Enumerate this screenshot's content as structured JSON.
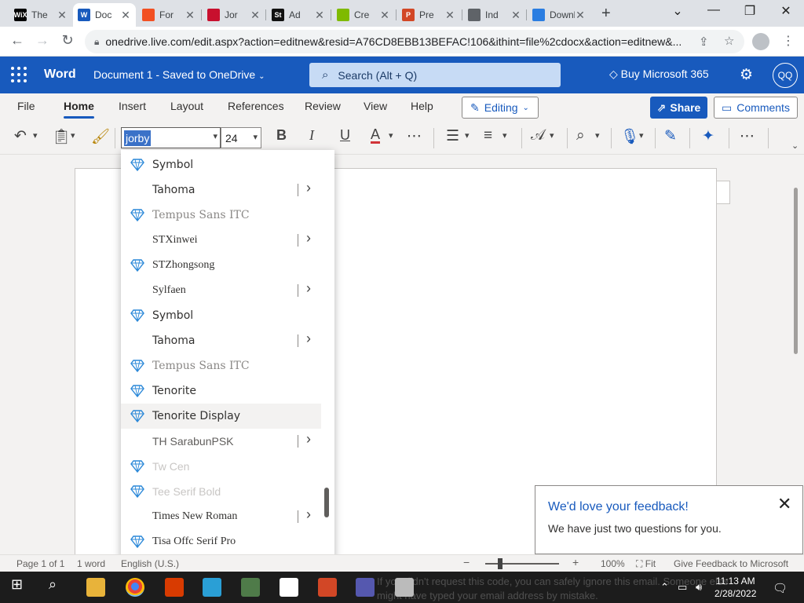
{
  "browser": {
    "tabs": [
      {
        "title": "The",
        "favicon": "wix-icon",
        "fav_text": "WiX",
        "fav_color": "#000000"
      },
      {
        "title": "Doc",
        "favicon": "word-icon",
        "fav_text": "W",
        "fav_color": "#185abd",
        "active": true
      },
      {
        "title": "For",
        "favicon": "microsoft-icon",
        "fav_text": "",
        "fav_color": "#f25022"
      },
      {
        "title": "Jor",
        "favicon": "bookmark-red-icon",
        "fav_text": "",
        "fav_color": "#c8102e"
      },
      {
        "title": "Ad",
        "favicon": "st-icon",
        "fav_text": "St",
        "fav_color": "#111111"
      },
      {
        "title": "Cre",
        "favicon": "microsoft-icon",
        "fav_text": "",
        "fav_color": "#7fba00"
      },
      {
        "title": "Pre",
        "favicon": "powerpoint-icon",
        "fav_text": "P",
        "fav_color": "#d24726"
      },
      {
        "title": "Ind",
        "favicon": "globe-icon",
        "fav_text": "",
        "fav_color": "#5f6368"
      },
      {
        "title": "Downlo",
        "favicon": "download-swirl-icon",
        "fav_text": "",
        "fav_color": "#2a7de1"
      }
    ],
    "url": "onedrive.live.com/edit.aspx?action=editnew&resid=A76CD8EBB13BEFAC!106&ithint=file%2cdocx&action=editnew&..."
  },
  "word": {
    "app_name": "Word",
    "doc_title": "Document 1  -  Saved to OneDrive",
    "search_placeholder": "Search (Alt + Q)",
    "buy_label": "Buy Microsoft 365",
    "avatar_initials": "QQ",
    "ribbon_tabs": [
      "File",
      "Home",
      "Insert",
      "Layout",
      "References",
      "Review",
      "View",
      "Help"
    ],
    "active_tab": "Home",
    "editing_label": "Editing",
    "share_label": "Share",
    "comments_label": "Comments",
    "font_name_value": "jorby",
    "font_size_value": "24"
  },
  "font_dropdown": {
    "items": [
      {
        "name": "Symbol",
        "premium": true,
        "submenu": false,
        "font": "DejaVu Sans",
        "color": "#323130"
      },
      {
        "name": "Tahoma",
        "premium": false,
        "submenu": true,
        "font": "DejaVu Sans",
        "color": "#323130"
      },
      {
        "name": "Tempus Sans ITC",
        "premium": true,
        "submenu": false,
        "font": "DejaVu Serif",
        "color": "#8a8886"
      },
      {
        "name": "STXinwei",
        "premium": false,
        "submenu": true,
        "font": "Liberation Serif",
        "color": "#323130"
      },
      {
        "name": "STZhongsong",
        "premium": true,
        "submenu": false,
        "font": "Liberation Serif",
        "color": "#323130"
      },
      {
        "name": "Sylfaen",
        "premium": false,
        "submenu": true,
        "font": "Liberation Serif",
        "color": "#323130"
      },
      {
        "name": "Symbol",
        "premium": true,
        "submenu": false,
        "font": "DejaVu Sans",
        "color": "#323130"
      },
      {
        "name": "Tahoma",
        "premium": false,
        "submenu": true,
        "font": "DejaVu Sans",
        "color": "#323130"
      },
      {
        "name": "Tempus Sans ITC",
        "premium": true,
        "submenu": false,
        "font": "DejaVu Serif",
        "color": "#8a8886"
      },
      {
        "name": "Tenorite",
        "premium": true,
        "submenu": false,
        "font": "DejaVu Sans",
        "color": "#323130"
      },
      {
        "name": "Tenorite Display",
        "premium": true,
        "submenu": false,
        "font": "DejaVu Sans",
        "color": "#323130",
        "hover": true
      },
      {
        "name": "TH SarabunPSK",
        "premium": false,
        "submenu": true,
        "font": "Liberation Sans",
        "color": "#605e5c"
      },
      {
        "name": "Tw Cen",
        "premium": true,
        "submenu": false,
        "font": "Liberation Sans",
        "color": "#c8c6c4"
      },
      {
        "name": "Tee Serif Bold",
        "premium": true,
        "submenu": false,
        "font": "Liberation Sans",
        "color": "#c8c6c4"
      },
      {
        "name": "Times New Roman",
        "premium": false,
        "submenu": true,
        "font": "Liberation Serif",
        "color": "#323130"
      },
      {
        "name": "Tisa Offc Serif Pro",
        "premium": true,
        "submenu": false,
        "font": "Liberation Serif",
        "color": "#323130"
      }
    ]
  },
  "feedback": {
    "title": "We'd love your feedback!",
    "body": "We have just two questions for you."
  },
  "statusbar": {
    "page": "Page 1 of 1",
    "words": "1 word",
    "language": "English (U.S.)",
    "zoom": "100%",
    "fit": "Fit",
    "feedback": "Give Feedback to Microsoft"
  },
  "taskbar": {
    "time": "11:13 AM",
    "date": "2/28/2022",
    "ghost_line1": "If you didn't request this code, you can safely ignore this email. Someone else",
    "ghost_line2": "might have typed your email address by mistake."
  }
}
